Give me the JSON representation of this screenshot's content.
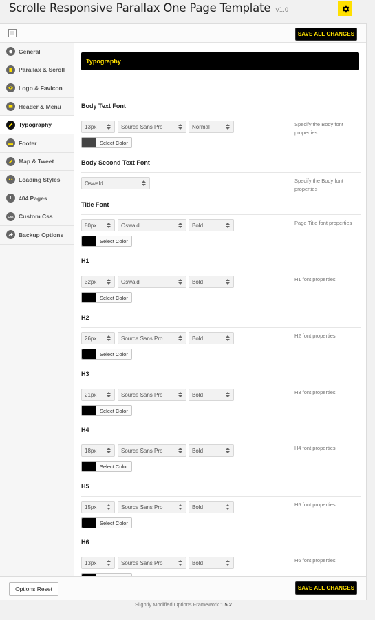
{
  "header": {
    "title": "Scrolle Responsive Parallax One Page Template",
    "version": "v1.0"
  },
  "toolbar": {
    "save_label": "SAVE ALL CHANGES",
    "reset_label": "Options Reset"
  },
  "colors": {
    "accent": "#ffe000",
    "dark": "#000000"
  },
  "sidebar": {
    "items": [
      {
        "label": "General",
        "icon": "house-icon"
      },
      {
        "label": "Parallax & Scroll",
        "icon": "scroll-icon"
      },
      {
        "label": "Logo & Favicon",
        "icon": "eye-icon"
      },
      {
        "label": "Header & Menu",
        "icon": "menu-icon"
      },
      {
        "label": "Typography",
        "icon": "pencil-icon"
      },
      {
        "label": "Footer",
        "icon": "footer-icon"
      },
      {
        "label": "Map & Tweet",
        "icon": "map-pencil-icon"
      },
      {
        "label": "Loading Styles",
        "icon": "loading-dots-icon"
      },
      {
        "label": "404 Pages",
        "icon": "exclamation-icon"
      },
      {
        "label": "Custom Css",
        "icon": "css-icon"
      },
      {
        "label": "Backup Options",
        "icon": "share-arrow-icon"
      }
    ],
    "active_index": 4
  },
  "section": {
    "title": "Typography"
  },
  "options": [
    {
      "title": "Body Text Font",
      "size": "13px",
      "family": "Source Sans Pro",
      "weight": "Normal",
      "color": "#444444",
      "color_label": "Select Color",
      "desc": "Specify the Body font properties"
    },
    {
      "title": "Body Second Text Font",
      "family": "Oswald",
      "desc": "Specify the Body font properties"
    },
    {
      "title": "Title Font",
      "size": "80px",
      "family": "Oswald",
      "weight": "Bold",
      "color": "#000000",
      "color_label": "Select Color",
      "desc": "Page Title font properties"
    },
    {
      "title": "H1",
      "size": "32px",
      "family": "Oswald",
      "weight": "Bold",
      "color": "#000000",
      "color_label": "Select Color",
      "desc": "H1 font properties"
    },
    {
      "title": "H2",
      "size": "26px",
      "family": "Source Sans Pro",
      "weight": "Bold",
      "color": "#000000",
      "color_label": "Select Color",
      "desc": "H2 font properties"
    },
    {
      "title": "H3",
      "size": "21px",
      "family": "Source Sans Pro",
      "weight": "Bold",
      "color": "#000000",
      "color_label": "Select Color",
      "desc": "H3 font properties"
    },
    {
      "title": "H4",
      "size": "18px",
      "family": "Source Sans Pro",
      "weight": "Bold",
      "color": "#000000",
      "color_label": "Select Color",
      "desc": "H4 font properties"
    },
    {
      "title": "H5",
      "size": "15px",
      "family": "Source Sans Pro",
      "weight": "Bold",
      "color": "#000000",
      "color_label": "Select Color",
      "desc": "H5 font properties"
    },
    {
      "title": "H6",
      "size": "13px",
      "family": "Source Sans Pro",
      "weight": "Bold",
      "color": "#000000",
      "color_label": "Select Color",
      "desc": "H6 font properties"
    }
  ],
  "footer": {
    "text": "Slightly Modified Options Framework",
    "version": "1.5.2"
  }
}
